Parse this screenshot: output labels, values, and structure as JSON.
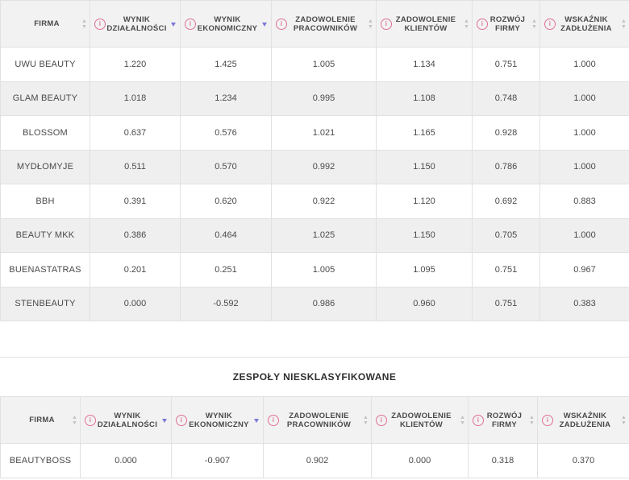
{
  "columns": {
    "firma": "FIRMA",
    "wynik_dzialalnosci": "WYNIK DZIAŁALNOŚCI",
    "wynik_ekonomiczny": "WYNIK EKONOMICZNY",
    "zadowolenie_pracownikow": "ZADOWOLENIE PRACOWNIKÓW",
    "zadowolenie_klientow": "ZADOWOLENIE KLIENTÓW",
    "rozwoj_firmy": "ROZWÓJ FIRMY",
    "wskaznik_zadluzenia": "WSKAŹNIK ZADŁUŻENIA"
  },
  "info_icon_glyph": "i",
  "sort_up_glyph": "▲",
  "sort_down_glyph": "▼",
  "accent_colors": {
    "info_icon": "#e0709a",
    "active_sort": "#7a79d8"
  },
  "main_table": {
    "rows": [
      [
        "UWU BEAUTY",
        "1.220",
        "1.425",
        "1.005",
        "1.134",
        "0.751",
        "1.000"
      ],
      [
        "GLAM BEAUTY",
        "1.018",
        "1.234",
        "0.995",
        "1.108",
        "0.748",
        "1.000"
      ],
      [
        "BLOSSOM",
        "0.637",
        "0.576",
        "1.021",
        "1.165",
        "0.928",
        "1.000"
      ],
      [
        "MYDŁOMYJE",
        "0.511",
        "0.570",
        "0.992",
        "1.150",
        "0.786",
        "1.000"
      ],
      [
        "BBH",
        "0.391",
        "0.620",
        "0.922",
        "1.120",
        "0.692",
        "0.883"
      ],
      [
        "BEAUTY MKK",
        "0.386",
        "0.464",
        "1.025",
        "1.150",
        "0.705",
        "1.000"
      ],
      [
        "BUENASTATRAS",
        "0.201",
        "0.251",
        "1.005",
        "1.095",
        "0.751",
        "0.967"
      ],
      [
        "STENBEAUTY",
        "0.000",
        "-0.592",
        "0.986",
        "0.960",
        "0.751",
        "0.383"
      ]
    ]
  },
  "unclassified": {
    "title": "ZESPOŁY NIESKLASYFIKOWANE",
    "rows": [
      [
        "BEAUTYBOSS",
        "0.000",
        "-0.907",
        "0.902",
        "0.000",
        "0.318",
        "0.370"
      ]
    ]
  }
}
